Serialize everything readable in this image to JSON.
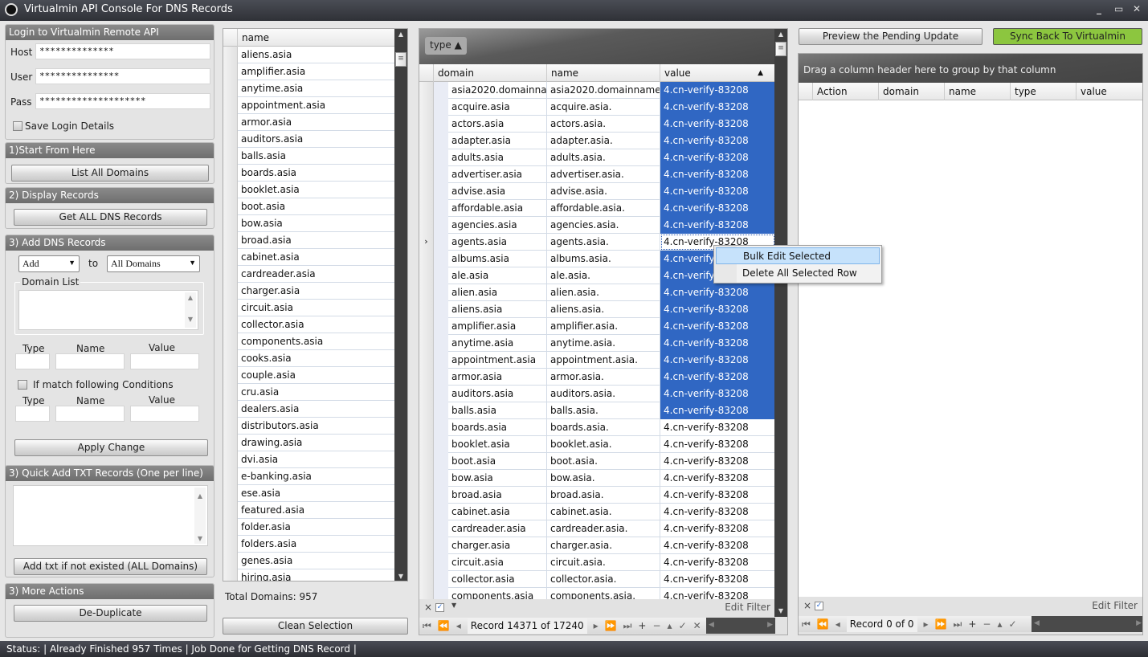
{
  "window": {
    "title": "Virtualmin API Console For DNS Records",
    "minimize": "_",
    "maximize": "▭",
    "close": "✕"
  },
  "login": {
    "header": "Login to Virtualmin Remote API",
    "host_label": "Host",
    "host_value": "**************",
    "user_label": "User",
    "user_value": "***************",
    "pass_label": "Pass",
    "pass_value": "********************",
    "save_label": "Save Login Details"
  },
  "step1": {
    "header": "1)Start From Here",
    "button": "List All Domains"
  },
  "step2": {
    "header": "2) Display Records",
    "button": "Get ALL DNS Records"
  },
  "step3": {
    "header": "3) Add DNS Records",
    "action_select": "Add",
    "to_label": "to",
    "target_select": "All Domains",
    "domain_list_label": "Domain List",
    "type_label": "Type",
    "name_label": "Name",
    "value_label": "Value",
    "condition_label": "If match following Conditions",
    "apply_button": "Apply Change"
  },
  "quick_txt": {
    "header": "3) Quick Add TXT Records  (One per line)",
    "button": "Add txt if not existed (ALL Domains)"
  },
  "more_actions": {
    "header": "3) More Actions",
    "button": "De-Duplicate"
  },
  "domain_list": {
    "column": "name",
    "items": [
      "aliens.asia",
      "amplifier.asia",
      "anytime.asia",
      "appointment.asia",
      "armor.asia",
      "auditors.asia",
      "balls.asia",
      "boards.asia",
      "booklet.asia",
      "boot.asia",
      "bow.asia",
      "broad.asia",
      "cabinet.asia",
      "cardreader.asia",
      "charger.asia",
      "circuit.asia",
      "collector.asia",
      "components.asia",
      "cooks.asia",
      "couple.asia",
      "cru.asia",
      "dealers.asia",
      "distributors.asia",
      "drawing.asia",
      "dvi.asia",
      "e-banking.asia",
      "ese.asia",
      "featured.asia",
      "folder.asia",
      "folders.asia",
      "genes.asia",
      "hiring.asia"
    ],
    "total": "Total Domains: 957",
    "clean_button": "Clean Selection"
  },
  "records": {
    "group_chip": "type ▲",
    "columns": [
      "domain",
      "name",
      "value"
    ],
    "sort_indicator": "▲",
    "rows": [
      {
        "domain": "asia2020.domainna...",
        "name": "asia2020.domainname...",
        "value": "4.cn-verify-83208",
        "selected": true
      },
      {
        "domain": "acquire.asia",
        "name": "acquire.asia.",
        "value": "4.cn-verify-83208",
        "selected": true
      },
      {
        "domain": "actors.asia",
        "name": "actors.asia.",
        "value": "4.cn-verify-83208",
        "selected": true
      },
      {
        "domain": "adapter.asia",
        "name": "adapter.asia.",
        "value": "4.cn-verify-83208",
        "selected": true
      },
      {
        "domain": "adults.asia",
        "name": "adults.asia.",
        "value": "4.cn-verify-83208",
        "selected": true
      },
      {
        "domain": "advertiser.asia",
        "name": "advertiser.asia.",
        "value": "4.cn-verify-83208",
        "selected": true
      },
      {
        "domain": "advise.asia",
        "name": "advise.asia.",
        "value": "4.cn-verify-83208",
        "selected": true
      },
      {
        "domain": "affordable.asia",
        "name": "affordable.asia.",
        "value": "4.cn-verify-83208",
        "selected": true
      },
      {
        "domain": "agencies.asia",
        "name": "agencies.asia.",
        "value": "4.cn-verify-83208",
        "selected": true
      },
      {
        "domain": "agents.asia",
        "name": "agents.asia.",
        "value": "4.cn-verify-83208",
        "selected": false,
        "current": true
      },
      {
        "domain": "albums.asia",
        "name": "albums.asia.",
        "value": "4.cn-verify-83208",
        "selected": true
      },
      {
        "domain": "ale.asia",
        "name": "ale.asia.",
        "value": "4.cn-verify-83208",
        "selected": true
      },
      {
        "domain": "alien.asia",
        "name": "alien.asia.",
        "value": "4.cn-verify-83208",
        "selected": true
      },
      {
        "domain": "aliens.asia",
        "name": "aliens.asia.",
        "value": "4.cn-verify-83208",
        "selected": true
      },
      {
        "domain": "amplifier.asia",
        "name": "amplifier.asia.",
        "value": "4.cn-verify-83208",
        "selected": true
      },
      {
        "domain": "anytime.asia",
        "name": "anytime.asia.",
        "value": "4.cn-verify-83208",
        "selected": true
      },
      {
        "domain": "appointment.asia",
        "name": "appointment.asia.",
        "value": "4.cn-verify-83208",
        "selected": true
      },
      {
        "domain": "armor.asia",
        "name": "armor.asia.",
        "value": "4.cn-verify-83208",
        "selected": true
      },
      {
        "domain": "auditors.asia",
        "name": "auditors.asia.",
        "value": "4.cn-verify-83208",
        "selected": true
      },
      {
        "domain": "balls.asia",
        "name": "balls.asia.",
        "value": "4.cn-verify-83208",
        "selected": true
      },
      {
        "domain": "boards.asia",
        "name": "boards.asia.",
        "value": "4.cn-verify-83208",
        "selected": false
      },
      {
        "domain": "booklet.asia",
        "name": "booklet.asia.",
        "value": "4.cn-verify-83208",
        "selected": false
      },
      {
        "domain": "boot.asia",
        "name": "boot.asia.",
        "value": "4.cn-verify-83208",
        "selected": false
      },
      {
        "domain": "bow.asia",
        "name": "bow.asia.",
        "value": "4.cn-verify-83208",
        "selected": false
      },
      {
        "domain": "broad.asia",
        "name": "broad.asia.",
        "value": "4.cn-verify-83208",
        "selected": false
      },
      {
        "domain": "cabinet.asia",
        "name": "cabinet.asia.",
        "value": "4.cn-verify-83208",
        "selected": false
      },
      {
        "domain": "cardreader.asia",
        "name": "cardreader.asia.",
        "value": "4.cn-verify-83208",
        "selected": false
      },
      {
        "domain": "charger.asia",
        "name": "charger.asia.",
        "value": "4.cn-verify-83208",
        "selected": false
      },
      {
        "domain": "circuit.asia",
        "name": "circuit.asia.",
        "value": "4.cn-verify-83208",
        "selected": false
      },
      {
        "domain": "collector.asia",
        "name": "collector.asia.",
        "value": "4.cn-verify-83208",
        "selected": false
      },
      {
        "domain": "components.asia",
        "name": "components.asia.",
        "value": "4.cn-verify-83208",
        "selected": false
      }
    ],
    "edit_filter": "Edit Filter",
    "record_nav": "Record 14371 of 17240"
  },
  "context_menu": {
    "items": [
      "Bulk Edit Selected",
      "Delete All Selected Row"
    ]
  },
  "pending": {
    "preview_button": "Preview the Pending Update",
    "sync_button": "Sync Back To Virtualmin",
    "sync_color": "#8cc63f",
    "group_hint": "Drag a column header here to group by that column",
    "columns": [
      "Action",
      "domain",
      "name",
      "type",
      "value"
    ],
    "edit_filter": "Edit Filter",
    "record_nav": "Record 0 of 0"
  },
  "status": {
    "text": "Status: | Already Finished 957 Times |  Job Done for Getting DNS Record |"
  }
}
